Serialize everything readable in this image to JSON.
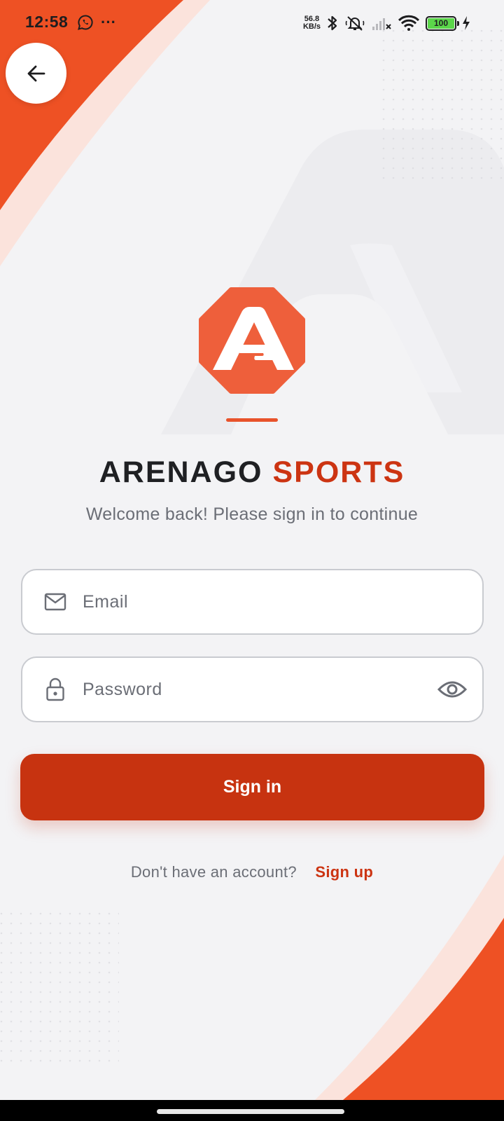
{
  "status_bar": {
    "time": "12:58",
    "more": "···",
    "net_speed_value": "56.8",
    "net_speed_unit": "KB/s",
    "battery_level": "100"
  },
  "brand": {
    "name_primary": "ARENAGO",
    "name_accent": "SPORTS",
    "welcome": "Welcome back! Please sign in to continue"
  },
  "form": {
    "email_placeholder": "Email",
    "email_value": "",
    "password_placeholder": "Password",
    "password_value": "",
    "signin_label": "Sign in"
  },
  "footer": {
    "prompt": "Don't have an account?",
    "signup_label": "Sign up"
  },
  "colors": {
    "accent": "#e8532b",
    "button": "#c73310",
    "link": "#cc3412",
    "background": "#f3f3f5"
  },
  "icons": {
    "back": "arrow-left-icon",
    "email": "mail-icon",
    "password": "lock-icon",
    "visibility": "eye-icon"
  }
}
